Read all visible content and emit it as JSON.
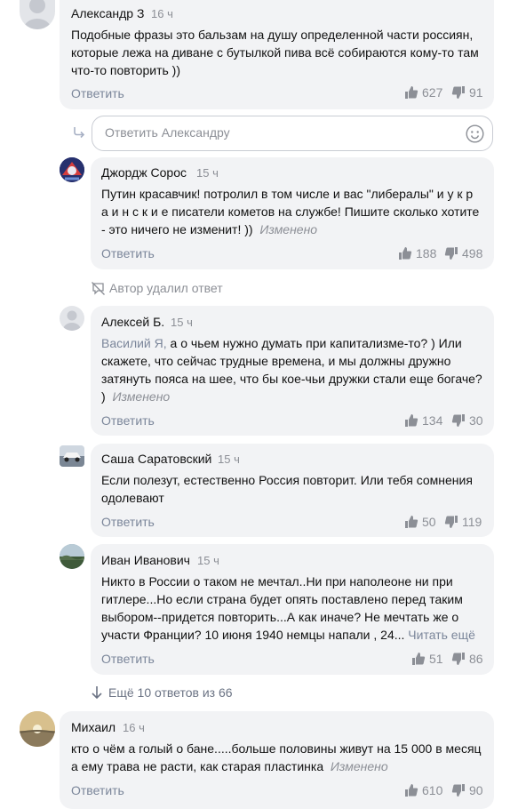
{
  "comments": [
    {
      "author": "Александр З",
      "time": "16 ч",
      "lines": [
        "Подобные фразы это бальзам на душу определенной части россиян,",
        "которые лежа на диване с бутылкой пива всё собираются кому-то там",
        "что-то повторить ))"
      ],
      "reply": "Ответить",
      "likes": "627",
      "dislikes": "91"
    },
    {
      "author": "Джордж Сорос",
      "time": "15 ч",
      "lines": [
        "Путин красавчик! потролил в том числе и вас \"либералы\" и у к р",
        "а и н с к и е писатели кометов на службе! Пишите сколько хотите",
        "- это ничего не изменит! ))"
      ],
      "edited": "Изменено",
      "reply": "Ответить",
      "likes": "188",
      "dislikes": "498"
    },
    {
      "author": "Алексей Б.",
      "time": "15 ч",
      "mention": "Василий Я,",
      "lines": [
        " а о чьем нужно думать при капитализме-то? ) Или",
        "скажете, что сейчас трудные времена, и мы должны дружно",
        "затянуть пояса на шее, что бы кое-чьи дружки стали еще богаче?",
        ")"
      ],
      "edited": "Изменено",
      "reply": "Ответить",
      "likes": "134",
      "dislikes": "30"
    },
    {
      "author": "Саша Саратовский",
      "time": "15 ч",
      "lines": [
        "Если полезут, естественно Россия повторит. Или тебя сомнения",
        "одолевают"
      ],
      "reply": "Ответить",
      "likes": "50",
      "dislikes": "119"
    },
    {
      "author": "Иван Иванович",
      "time": "15 ч",
      "lines": [
        "Никто в России о таком не мечтал..Ни при наполеоне ни при",
        "гитлере...Но если страна будет опять поставлено перед таким",
        "выбором--придется повторить...А как иначе?  Не мечтать же о",
        "участи Франции? 10 июня 1940 немцы напали , 24..."
      ],
      "read_more": "Читать ещё",
      "reply": "Ответить",
      "likes": "51",
      "dislikes": "86"
    },
    {
      "author": "Михаил",
      "time": "16 ч",
      "lines": [
        "кто о чём а голый о бане.....больше половины живут на 15 000 в месяц",
        "а ему трава не расти, как старая пластинка"
      ],
      "edited": "Изменено",
      "reply": "Ответить",
      "likes": "610",
      "dislikes": "90"
    }
  ],
  "reply_box": {
    "placeholder": "Ответить Александру"
  },
  "deleted_notice": "Автор удалил ответ",
  "more_replies": "Ещё 10 ответов из 66",
  "icons": {
    "like": "thumbs-up-icon",
    "dislike": "thumbs-down-icon",
    "emoji": "smile-icon",
    "reply_arrow": "reply-arrow-icon",
    "deleted": "deleted-comment-icon",
    "more": "arrow-down-icon"
  },
  "colors": {
    "bubble": "#f2f3f5",
    "link": "#7b869a",
    "muted": "#8c8f96"
  }
}
